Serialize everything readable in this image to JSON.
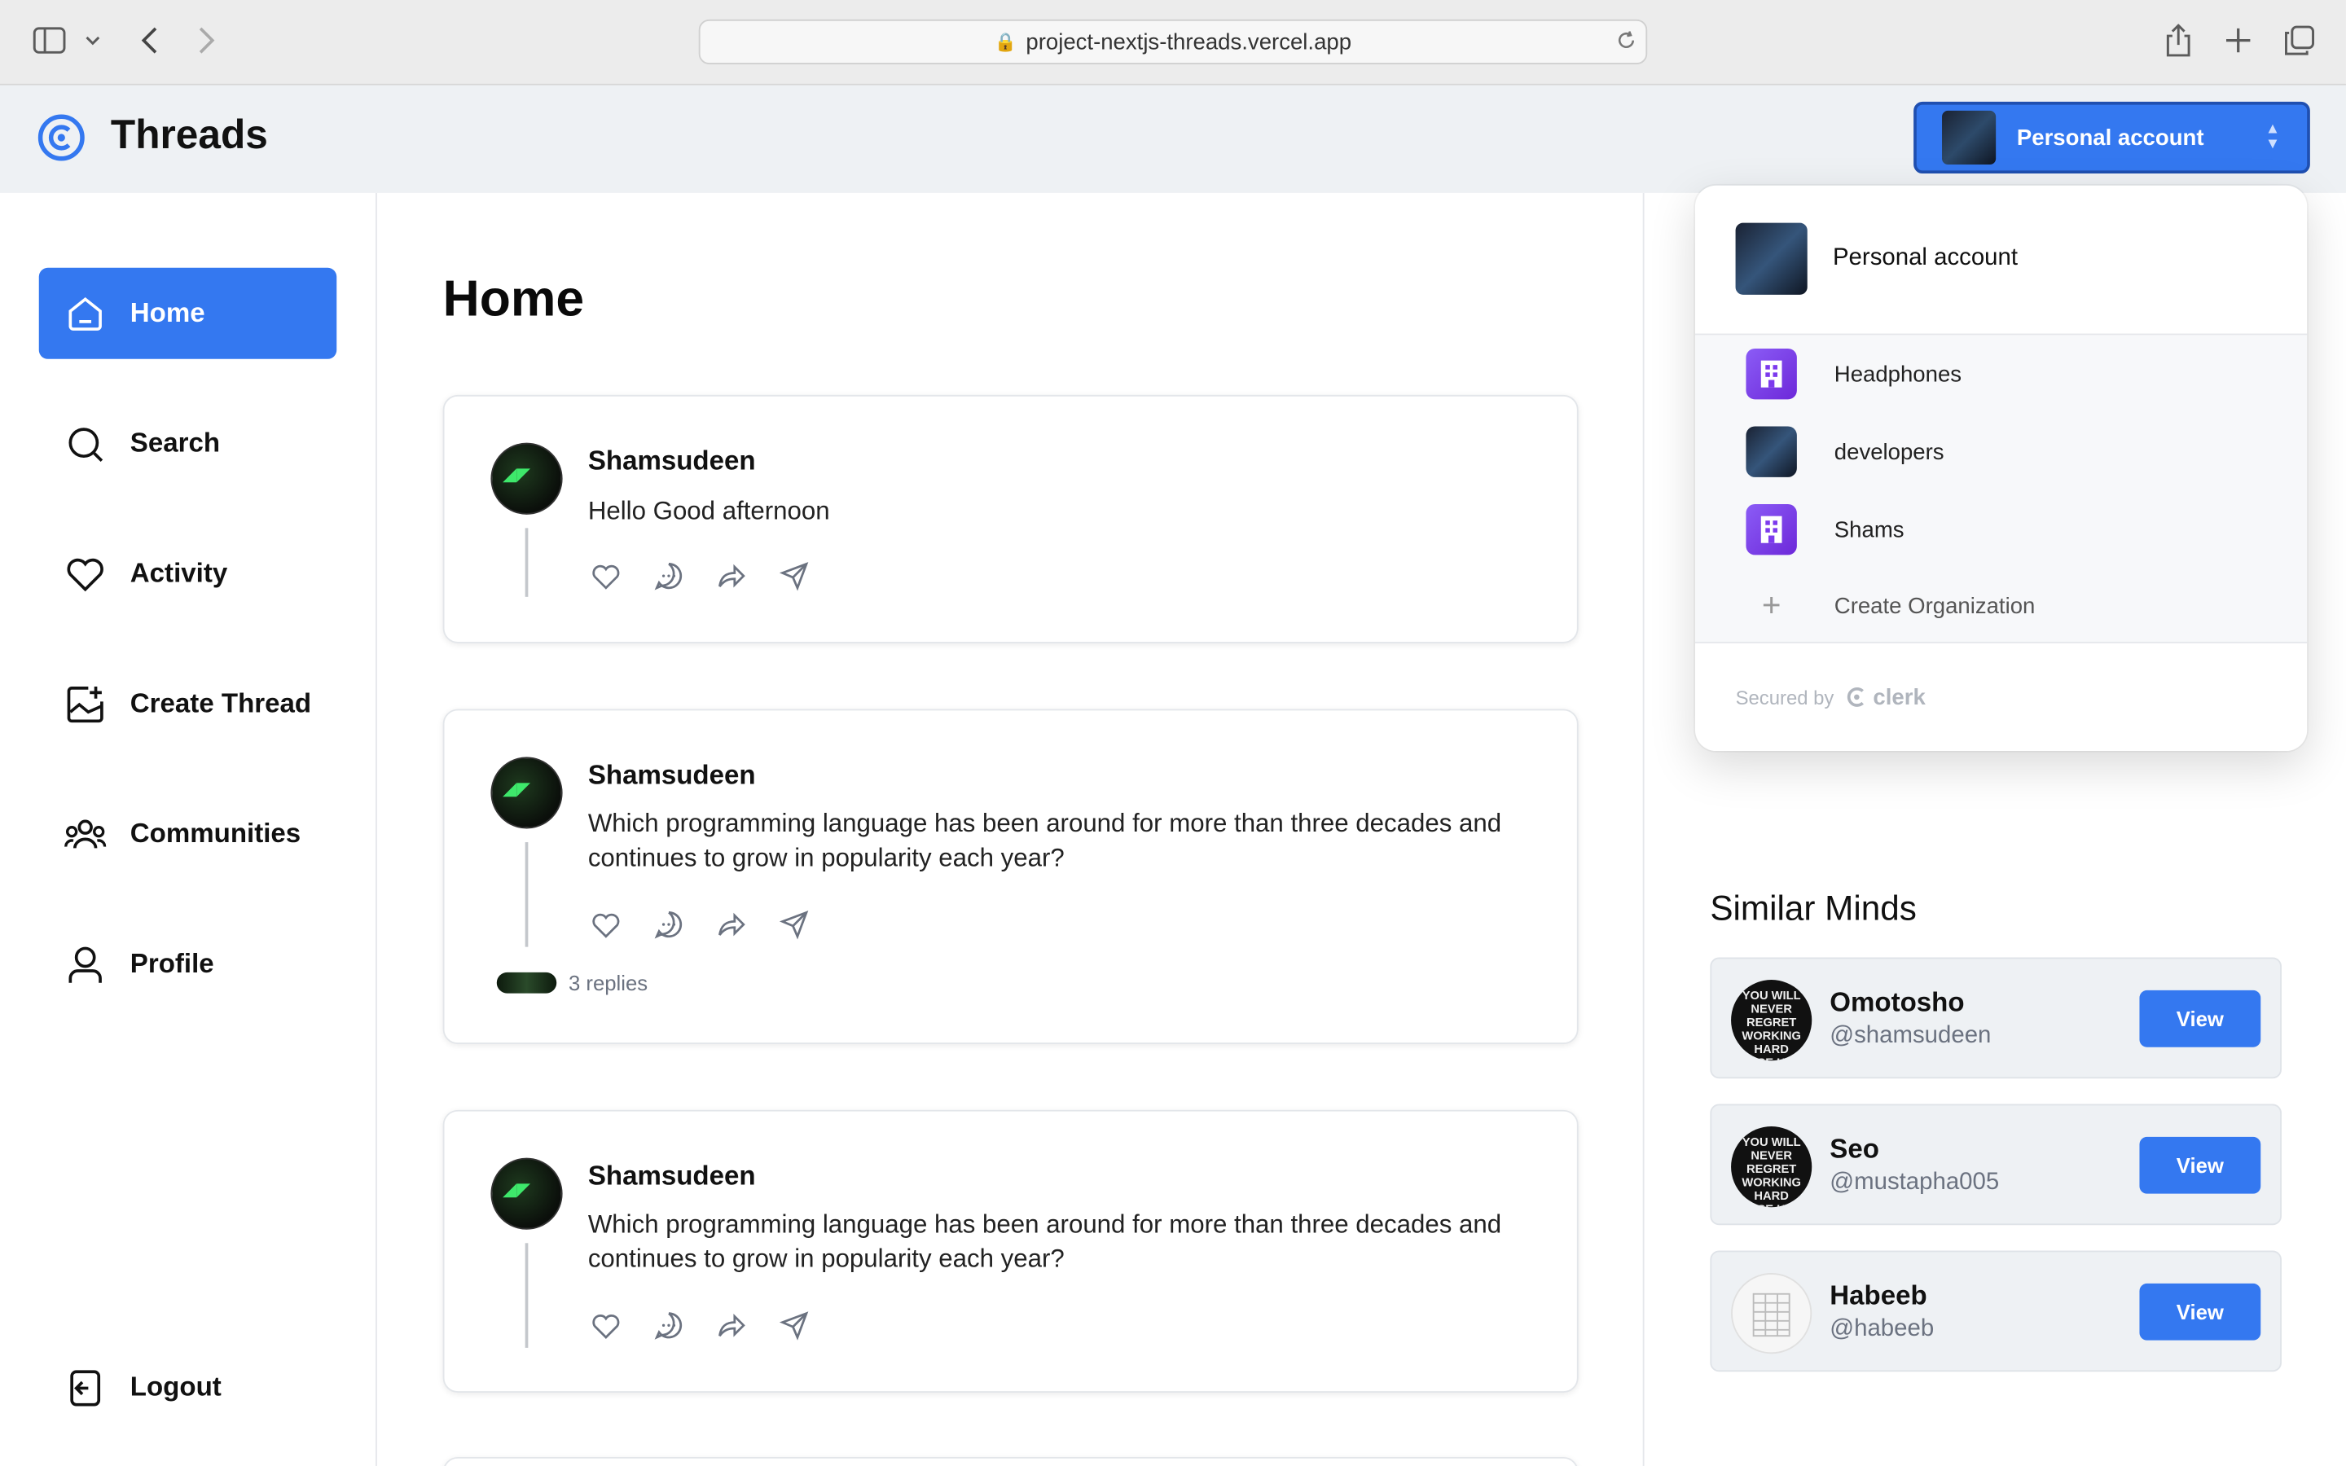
{
  "browser": {
    "url": "project-nextjs-threads.vercel.app"
  },
  "app": {
    "brand": "Threads"
  },
  "account_switcher": {
    "label": "Personal account",
    "dropdown": {
      "current": "Personal account",
      "organizations": [
        "Headphones",
        "developers",
        "Shams"
      ],
      "create_label": "Create Organization",
      "secured_by": "Secured by",
      "provider": "clerk"
    }
  },
  "sidebar": {
    "items": [
      {
        "label": "Home",
        "icon": "home-icon",
        "active": true
      },
      {
        "label": "Search",
        "icon": "search-icon"
      },
      {
        "label": "Activity",
        "icon": "heart-icon"
      },
      {
        "label": "Create Thread",
        "icon": "create-thread-icon"
      },
      {
        "label": "Communities",
        "icon": "communities-icon"
      },
      {
        "label": "Profile",
        "icon": "user-icon"
      }
    ],
    "logout": "Logout"
  },
  "main": {
    "title": "Home",
    "threads": [
      {
        "author": "Shamsudeen",
        "text": "Hello Good afternoon",
        "replies": ""
      },
      {
        "author": "Shamsudeen",
        "text": "Which programming language has been around for more than three decades and continues to grow in popularity each year?",
        "replies": "3 replies"
      },
      {
        "author": "Shamsudeen",
        "text": "Which programming language has been around for more than three decades and continues to grow in popularity each year?",
        "replies": ""
      }
    ]
  },
  "similar_minds": {
    "title": "Similar Minds",
    "view_label": "View",
    "users": [
      {
        "name": "Omotosho",
        "handle": "@shamsudeen"
      },
      {
        "name": "Seo",
        "handle": "@mustapha005"
      },
      {
        "name": "Habeeb",
        "handle": "@habeeb"
      }
    ]
  },
  "colors": {
    "accent": "#3478f0",
    "org_purple": "#7c3aed"
  }
}
